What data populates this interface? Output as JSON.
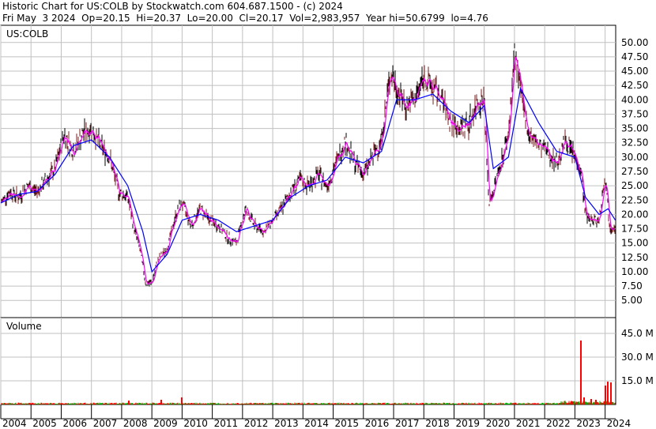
{
  "header": {
    "line1": "Historic Chart for US:COLB by Stockwatch.com 604.687.1500 - (c) 2024",
    "line2": "Fri May  3 2024  Op=20.15  Hi=20.37  Lo=20.00  Cl=20.17  Vol=2,983,957  Year hi=50.6799  lo=4.76"
  },
  "price_panel": {
    "label": "US:COLB"
  },
  "volume_panel": {
    "label": "Volume"
  },
  "colors": {
    "price_bar": "#000000",
    "ma_short": "#ff00ff",
    "ma_long": "#0000ff",
    "volume_up": "#00aa00",
    "volume_down": "#ff0000",
    "grid": "#c0c0c0"
  },
  "chart_data": [
    {
      "type": "line",
      "title": "US:COLB",
      "ylim": [
        2,
        53
      ],
      "yticks": [
        5.0,
        7.5,
        10.0,
        12.5,
        15.0,
        17.5,
        20.0,
        22.5,
        25.0,
        27.5,
        30.0,
        32.5,
        35.0,
        37.5,
        40.0,
        42.5,
        45.0,
        47.5,
        50.0
      ],
      "ytick_labels": [
        "5.00",
        "7.50",
        "10.00",
        "12.50",
        "15.00",
        "17.50",
        "20.00",
        "22.50",
        "25.00",
        "27.50",
        "30.00",
        "32.50",
        "35.00",
        "37.50",
        "40.00",
        "42.50",
        "45.00",
        "47.50",
        "50.00"
      ],
      "xlim": [
        2004.0,
        2024.35
      ],
      "xticks": [
        2004,
        2005,
        2006,
        2007,
        2008,
        2009,
        2010,
        2011,
        2012,
        2013,
        2014,
        2015,
        2016,
        2017,
        2018,
        2019,
        2020,
        2021,
        2022,
        2023,
        2024
      ],
      "xtick_labels": [
        "2004",
        "2005",
        "2006",
        "2007",
        "2008",
        "2009",
        "2010",
        "2011",
        "2012",
        "2013",
        "2014",
        "2015",
        "2016",
        "2017",
        "2018",
        "2019",
        "2020",
        "2021",
        "2022",
        "2023",
        "2024"
      ],
      "grid": true,
      "series": [
        {
          "x": [
            2004.0,
            2004.3,
            2004.6,
            2004.9,
            2005.2,
            2005.5,
            2005.8,
            2006.1,
            2006.4,
            2006.7,
            2007.0,
            2007.3,
            2007.6,
            2007.9,
            2008.2,
            2008.4,
            2008.6,
            2008.8,
            2009.0,
            2009.2,
            2009.5,
            2009.8,
            2010.0,
            2010.3,
            2010.6,
            2010.9,
            2011.2,
            2011.5,
            2011.8,
            2012.1,
            2012.4,
            2012.7,
            2013.0,
            2013.3,
            2013.6,
            2013.9,
            2014.2,
            2014.5,
            2014.8,
            2015.1,
            2015.4,
            2015.7,
            2016.0,
            2016.3,
            2016.6,
            2016.9,
            2017.1,
            2017.4,
            2017.7,
            2018.0,
            2018.3,
            2018.6,
            2018.9,
            2019.2,
            2019.5,
            2019.8,
            2020.0,
            2020.15,
            2020.3,
            2020.5,
            2020.8,
            2021.0,
            2021.15,
            2021.3,
            2021.5,
            2021.8,
            2022.1,
            2022.4,
            2022.7,
            2023.0,
            2023.2,
            2023.35,
            2023.5,
            2023.8,
            2024.0,
            2024.15,
            2024.34
          ],
          "values": [
            22,
            24,
            23,
            25,
            24,
            26,
            28,
            34,
            31,
            34,
            35,
            32,
            30,
            24,
            23,
            18,
            14,
            8,
            8,
            12,
            14,
            20,
            22,
            18,
            21,
            19,
            18,
            16,
            15,
            21,
            18,
            17,
            19,
            21,
            24,
            26,
            25,
            27,
            25,
            29,
            33,
            29,
            27,
            30,
            33,
            45,
            42,
            39,
            40,
            44,
            42,
            40,
            36,
            35,
            36,
            40,
            40,
            22,
            24,
            28,
            34,
            48,
            44,
            38,
            34,
            32,
            31,
            29,
            33,
            30,
            28,
            20,
            19,
            19,
            27,
            18,
            18
          ]
        },
        {
          "x": [
            2004.0,
            2004.6,
            2005.2,
            2005.8,
            2006.4,
            2007.0,
            2007.6,
            2008.2,
            2008.7,
            2009.0,
            2009.5,
            2010.0,
            2010.6,
            2011.2,
            2011.8,
            2012.4,
            2013.0,
            2013.6,
            2014.2,
            2014.8,
            2015.4,
            2016.0,
            2016.6,
            2017.1,
            2017.7,
            2018.3,
            2018.9,
            2019.5,
            2020.0,
            2020.3,
            2020.8,
            2021.2,
            2021.8,
            2022.4,
            2023.0,
            2023.35,
            2023.8,
            2024.1,
            2024.34
          ],
          "values": [
            22,
            23.5,
            24,
            27,
            32,
            33,
            30,
            25,
            17,
            10,
            13,
            19,
            20,
            19,
            17,
            18,
            19,
            23,
            25,
            26,
            30,
            29,
            31,
            40,
            40,
            41,
            38,
            36,
            39,
            28,
            30,
            42,
            36,
            31,
            30,
            23,
            20,
            21,
            19
          ]
        }
      ]
    },
    {
      "type": "bar",
      "title": "Volume",
      "ylim": [
        0,
        55
      ],
      "yticks": [
        15,
        30,
        45
      ],
      "ytick_labels": [
        "15.0 M",
        "30.0 M",
        "45.0 M"
      ],
      "spikes": [
        {
          "x": 2008.25,
          "value": 2.5
        },
        {
          "x": 2009.3,
          "value": 3.0
        },
        {
          "x": 2010.0,
          "value": 4.5
        },
        {
          "x": 2023.2,
          "value": 40.5
        },
        {
          "x": 2023.3,
          "value": 4.5
        },
        {
          "x": 2023.55,
          "value": 3.5
        },
        {
          "x": 2023.7,
          "value": 3.0
        },
        {
          "x": 2024.0,
          "value": 12.0
        },
        {
          "x": 2024.1,
          "value": 14.5
        },
        {
          "x": 2024.2,
          "value": 14.0
        }
      ]
    }
  ]
}
